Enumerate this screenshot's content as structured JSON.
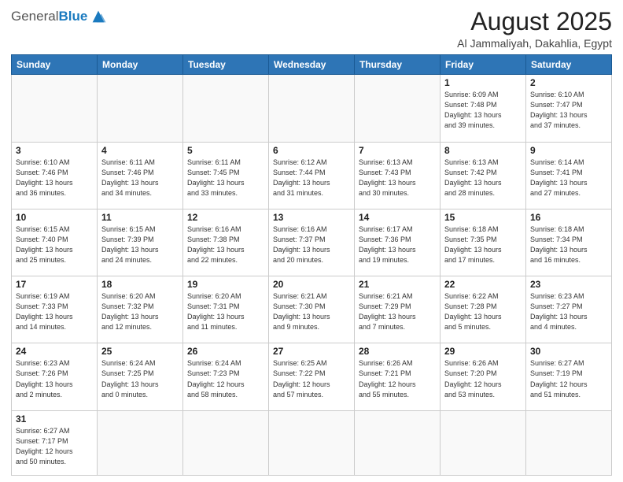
{
  "header": {
    "logo_general": "General",
    "logo_blue": "Blue",
    "title": "August 2025",
    "location": "Al Jammaliyah, Dakahlia, Egypt"
  },
  "days_of_week": [
    "Sunday",
    "Monday",
    "Tuesday",
    "Wednesday",
    "Thursday",
    "Friday",
    "Saturday"
  ],
  "weeks": [
    [
      {
        "num": "",
        "info": ""
      },
      {
        "num": "",
        "info": ""
      },
      {
        "num": "",
        "info": ""
      },
      {
        "num": "",
        "info": ""
      },
      {
        "num": "",
        "info": ""
      },
      {
        "num": "1",
        "info": "Sunrise: 6:09 AM\nSunset: 7:48 PM\nDaylight: 13 hours\nand 39 minutes."
      },
      {
        "num": "2",
        "info": "Sunrise: 6:10 AM\nSunset: 7:47 PM\nDaylight: 13 hours\nand 37 minutes."
      }
    ],
    [
      {
        "num": "3",
        "info": "Sunrise: 6:10 AM\nSunset: 7:46 PM\nDaylight: 13 hours\nand 36 minutes."
      },
      {
        "num": "4",
        "info": "Sunrise: 6:11 AM\nSunset: 7:46 PM\nDaylight: 13 hours\nand 34 minutes."
      },
      {
        "num": "5",
        "info": "Sunrise: 6:11 AM\nSunset: 7:45 PM\nDaylight: 13 hours\nand 33 minutes."
      },
      {
        "num": "6",
        "info": "Sunrise: 6:12 AM\nSunset: 7:44 PM\nDaylight: 13 hours\nand 31 minutes."
      },
      {
        "num": "7",
        "info": "Sunrise: 6:13 AM\nSunset: 7:43 PM\nDaylight: 13 hours\nand 30 minutes."
      },
      {
        "num": "8",
        "info": "Sunrise: 6:13 AM\nSunset: 7:42 PM\nDaylight: 13 hours\nand 28 minutes."
      },
      {
        "num": "9",
        "info": "Sunrise: 6:14 AM\nSunset: 7:41 PM\nDaylight: 13 hours\nand 27 minutes."
      }
    ],
    [
      {
        "num": "10",
        "info": "Sunrise: 6:15 AM\nSunset: 7:40 PM\nDaylight: 13 hours\nand 25 minutes."
      },
      {
        "num": "11",
        "info": "Sunrise: 6:15 AM\nSunset: 7:39 PM\nDaylight: 13 hours\nand 24 minutes."
      },
      {
        "num": "12",
        "info": "Sunrise: 6:16 AM\nSunset: 7:38 PM\nDaylight: 13 hours\nand 22 minutes."
      },
      {
        "num": "13",
        "info": "Sunrise: 6:16 AM\nSunset: 7:37 PM\nDaylight: 13 hours\nand 20 minutes."
      },
      {
        "num": "14",
        "info": "Sunrise: 6:17 AM\nSunset: 7:36 PM\nDaylight: 13 hours\nand 19 minutes."
      },
      {
        "num": "15",
        "info": "Sunrise: 6:18 AM\nSunset: 7:35 PM\nDaylight: 13 hours\nand 17 minutes."
      },
      {
        "num": "16",
        "info": "Sunrise: 6:18 AM\nSunset: 7:34 PM\nDaylight: 13 hours\nand 16 minutes."
      }
    ],
    [
      {
        "num": "17",
        "info": "Sunrise: 6:19 AM\nSunset: 7:33 PM\nDaylight: 13 hours\nand 14 minutes."
      },
      {
        "num": "18",
        "info": "Sunrise: 6:20 AM\nSunset: 7:32 PM\nDaylight: 13 hours\nand 12 minutes."
      },
      {
        "num": "19",
        "info": "Sunrise: 6:20 AM\nSunset: 7:31 PM\nDaylight: 13 hours\nand 11 minutes."
      },
      {
        "num": "20",
        "info": "Sunrise: 6:21 AM\nSunset: 7:30 PM\nDaylight: 13 hours\nand 9 minutes."
      },
      {
        "num": "21",
        "info": "Sunrise: 6:21 AM\nSunset: 7:29 PM\nDaylight: 13 hours\nand 7 minutes."
      },
      {
        "num": "22",
        "info": "Sunrise: 6:22 AM\nSunset: 7:28 PM\nDaylight: 13 hours\nand 5 minutes."
      },
      {
        "num": "23",
        "info": "Sunrise: 6:23 AM\nSunset: 7:27 PM\nDaylight: 13 hours\nand 4 minutes."
      }
    ],
    [
      {
        "num": "24",
        "info": "Sunrise: 6:23 AM\nSunset: 7:26 PM\nDaylight: 13 hours\nand 2 minutes."
      },
      {
        "num": "25",
        "info": "Sunrise: 6:24 AM\nSunset: 7:25 PM\nDaylight: 13 hours\nand 0 minutes."
      },
      {
        "num": "26",
        "info": "Sunrise: 6:24 AM\nSunset: 7:23 PM\nDaylight: 12 hours\nand 58 minutes."
      },
      {
        "num": "27",
        "info": "Sunrise: 6:25 AM\nSunset: 7:22 PM\nDaylight: 12 hours\nand 57 minutes."
      },
      {
        "num": "28",
        "info": "Sunrise: 6:26 AM\nSunset: 7:21 PM\nDaylight: 12 hours\nand 55 minutes."
      },
      {
        "num": "29",
        "info": "Sunrise: 6:26 AM\nSunset: 7:20 PM\nDaylight: 12 hours\nand 53 minutes."
      },
      {
        "num": "30",
        "info": "Sunrise: 6:27 AM\nSunset: 7:19 PM\nDaylight: 12 hours\nand 51 minutes."
      }
    ],
    [
      {
        "num": "31",
        "info": "Sunrise: 6:27 AM\nSunset: 7:17 PM\nDaylight: 12 hours\nand 50 minutes."
      },
      {
        "num": "",
        "info": ""
      },
      {
        "num": "",
        "info": ""
      },
      {
        "num": "",
        "info": ""
      },
      {
        "num": "",
        "info": ""
      },
      {
        "num": "",
        "info": ""
      },
      {
        "num": "",
        "info": ""
      }
    ]
  ]
}
